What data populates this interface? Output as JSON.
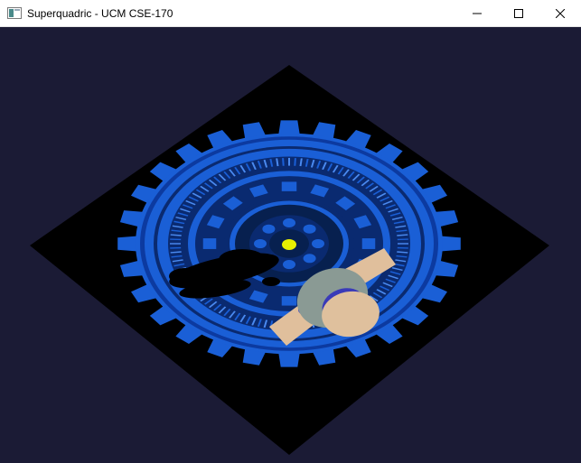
{
  "window": {
    "title": "Superquadric - UCM CSE-170",
    "controls": {
      "minimize_icon": "minimize-icon",
      "maximize_icon": "maximize-icon",
      "close_icon": "close-icon"
    }
  },
  "scene": {
    "background_color": "#1b1b35",
    "floor_color": "#000000",
    "texture_primary_color": "#1a5fd6",
    "texture_detail_color": "#0a2a70",
    "center_dot_color": "#e8f000",
    "shadow_color": "#000000",
    "superquadric_colors": {
      "arm": "#e0bf9c",
      "disk": "#dfc09d",
      "ring": "#8a9a94",
      "accent": "#3030d0"
    }
  }
}
